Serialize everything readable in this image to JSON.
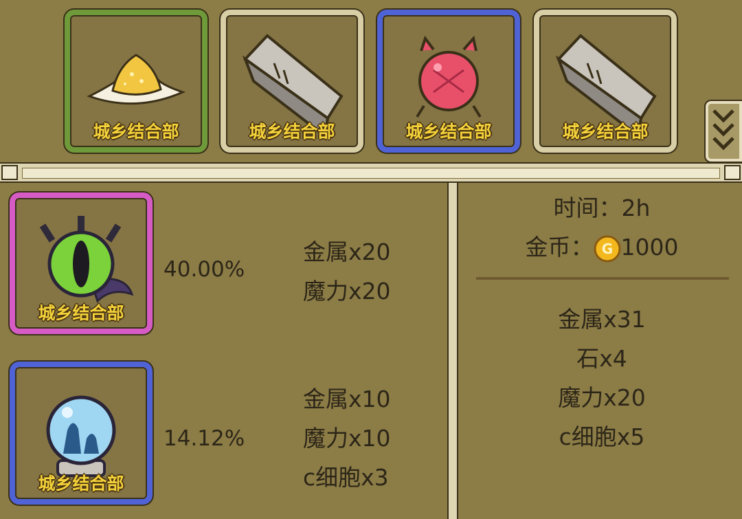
{
  "items_row": [
    {
      "tag": "城乡结合部",
      "icon": "sand-pile-icon",
      "rarity_color": "#6f9a3a"
    },
    {
      "tag": "城乡结合部",
      "icon": "stone-block-icon",
      "rarity_color": "#d9cfa6"
    },
    {
      "tag": "城乡结合部",
      "icon": "red-orb-icon",
      "rarity_color": "#4f63d6"
    },
    {
      "tag": "城乡结合部",
      "icon": "stone-block-icon",
      "rarity_color": "#d9cfa6"
    }
  ],
  "recipes": [
    {
      "tag": "城乡结合部",
      "icon": "eye-amulet-icon",
      "rarity_color": "#d65bc4",
      "chance": "40.00%",
      "materials": [
        "金属x20",
        "魔力x20"
      ]
    },
    {
      "tag": "城乡结合部",
      "icon": "crystal-globe-icon",
      "rarity_color": "#4f63d6",
      "chance": "14.12%",
      "materials": [
        "金属x10",
        "魔力x10",
        "c细胞x3"
      ]
    }
  ],
  "summary": {
    "time": "时间：2h",
    "gold_label": "金币：",
    "gold_value": "1000",
    "totals": [
      "金属x31",
      "石x4",
      "魔力x20",
      "c细胞x5"
    ]
  },
  "colors": {
    "background": "#8c7c46",
    "tag_text": "#f4d23a"
  }
}
